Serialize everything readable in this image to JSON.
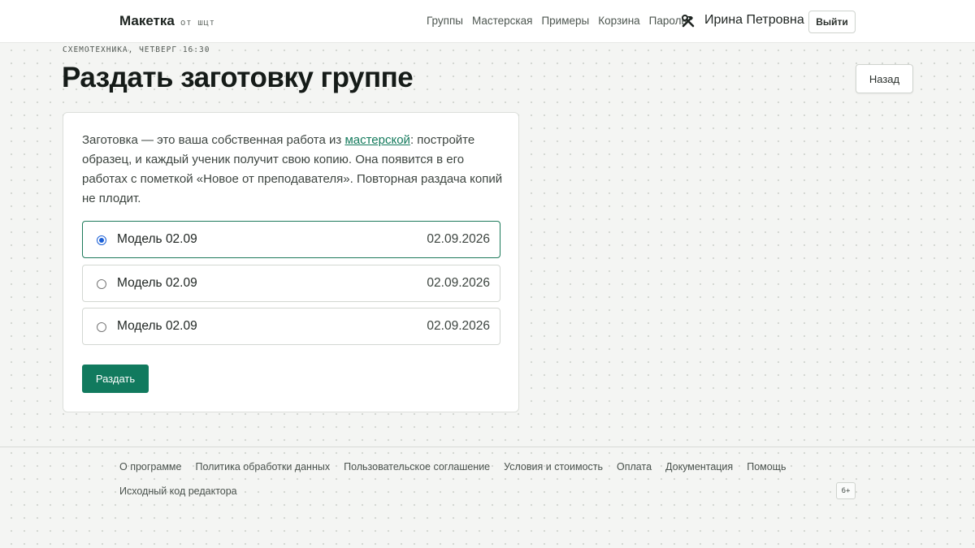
{
  "header": {
    "brand_name": "Макетка",
    "brand_sub": "от шцт",
    "nav": [
      "Группы",
      "Мастерская",
      "Примеры",
      "Корзина",
      "Пароль"
    ],
    "tools_icon": "hammer-wrench-icon",
    "user_name": "Ирина Петровна",
    "logout_label": "Выйти"
  },
  "page": {
    "kicker": "СХЕМОТЕХНИКА, ЧЕТВЕРГ 16:30",
    "title": "Раздать заготовку группе",
    "back_label": "Назад"
  },
  "card": {
    "intro_before": "Заготовка — это ваша собственная работа из ",
    "intro_link": "мастерской",
    "intro_after": ": постройте образец, и каждый ученик получит свою копию. Она появится в его работах с пометкой «Новое от преподавателя». Повторная раздача копий не плодит.",
    "options": [
      {
        "name": "Модель 02.09",
        "date": "02.09.2026",
        "selected": true
      },
      {
        "name": "Модель 02.09",
        "date": "02.09.2026",
        "selected": false
      },
      {
        "name": "Модель 02.09",
        "date": "02.09.2026",
        "selected": false
      }
    ],
    "submit_label": "Раздать"
  },
  "footer": {
    "links": [
      "О программе",
      "Политика обработки данных",
      "Пользовательское соглашение",
      "Условия и стоимость",
      "Оплата",
      "Документация",
      "Помощь"
    ],
    "source_link": "Исходный код редактора",
    "age_badge": "6+"
  },
  "colors": {
    "accent": "#117a5e",
    "link": "#147a5c",
    "radio_selected": "#1a5fd6"
  }
}
